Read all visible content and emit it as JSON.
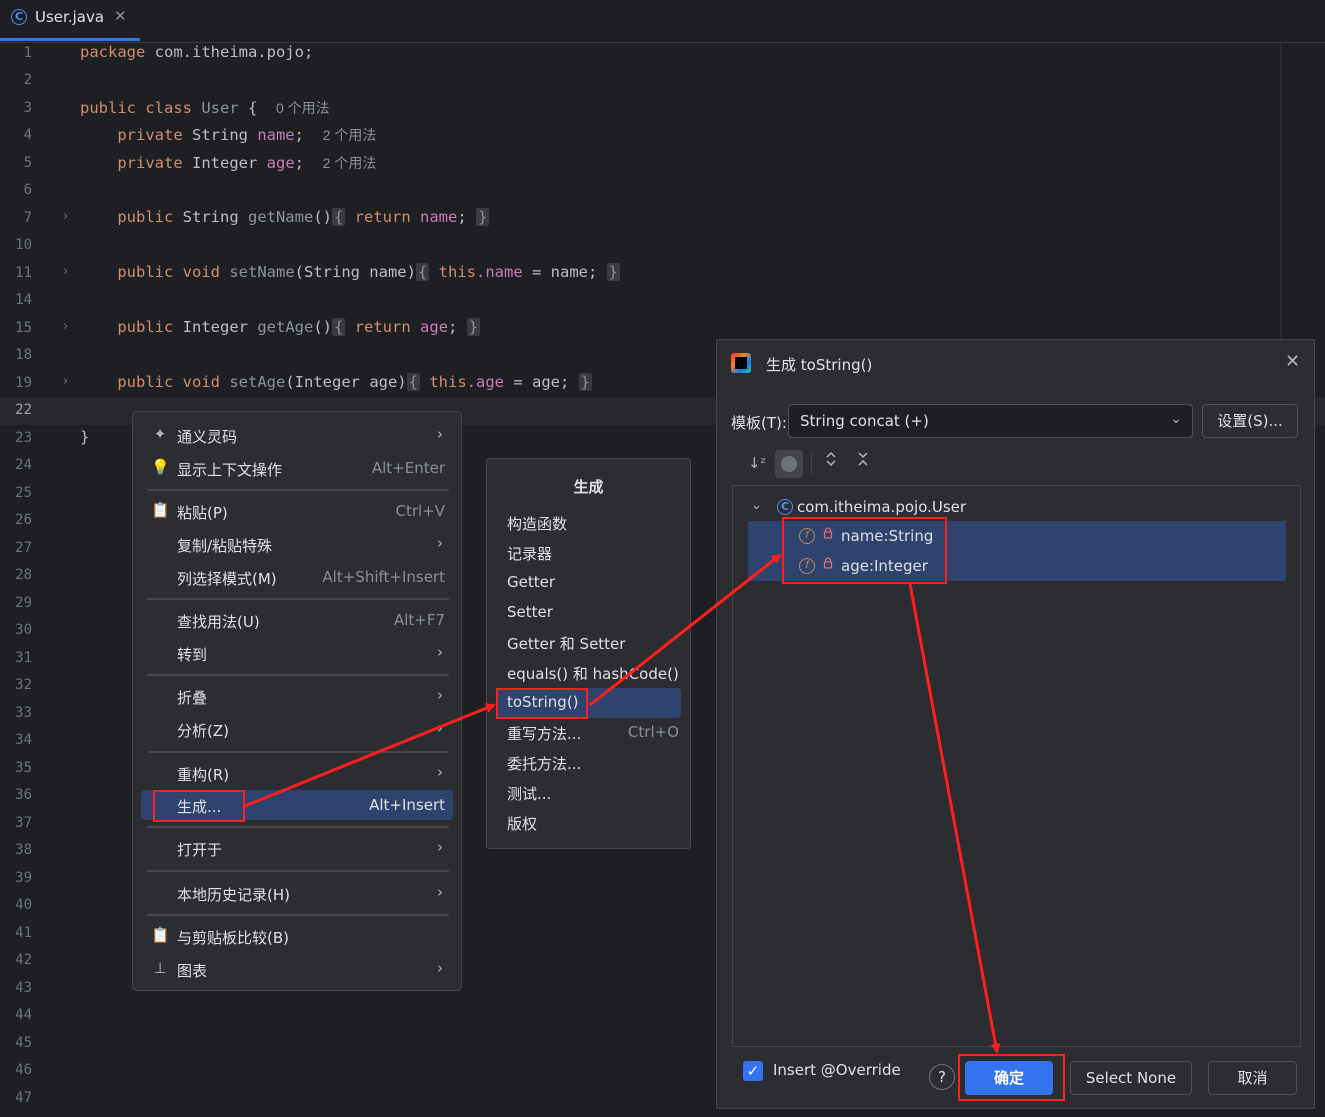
{
  "tab": {
    "title": "User.java",
    "close": "✕",
    "icon": "C"
  },
  "editor": {
    "lines": [
      {
        "n": "1"
      },
      {
        "n": "2"
      },
      {
        "n": "3"
      },
      {
        "n": "4"
      },
      {
        "n": "5"
      },
      {
        "n": "6"
      },
      {
        "n": "7"
      },
      {
        "n": "10"
      },
      {
        "n": "11"
      },
      {
        "n": "14"
      },
      {
        "n": "15"
      },
      {
        "n": "18"
      },
      {
        "n": "19"
      },
      {
        "n": "22"
      },
      {
        "n": "23"
      },
      {
        "n": "24"
      },
      {
        "n": "25"
      },
      {
        "n": "26"
      },
      {
        "n": "27"
      },
      {
        "n": "28"
      },
      {
        "n": "29"
      },
      {
        "n": "30"
      },
      {
        "n": "31"
      },
      {
        "n": "32"
      },
      {
        "n": "33"
      },
      {
        "n": "34"
      },
      {
        "n": "35"
      },
      {
        "n": "36"
      },
      {
        "n": "37"
      },
      {
        "n": "38"
      },
      {
        "n": "39"
      },
      {
        "n": "40"
      },
      {
        "n": "41"
      },
      {
        "n": "42"
      },
      {
        "n": "43"
      },
      {
        "n": "44"
      },
      {
        "n": "45"
      },
      {
        "n": "46"
      },
      {
        "n": "47"
      }
    ],
    "code": {
      "l1_kw": "package",
      "l1_rest": " com.itheima.pojo;",
      "l3_kw": "public class",
      "l3_name": "User",
      "l3_brace": " {",
      "l3_hint": "0 个用法",
      "l4_kw": "private",
      "l4_type": " String ",
      "l4_field": "name",
      "l4_semi": ";",
      "l4_hint": "2 个用法",
      "l5_kw": "private",
      "l5_type": " Integer ",
      "l5_field": "age",
      "l5_semi": ";",
      "l5_hint": "2 个用法",
      "l7_kw": "public",
      "l7_type": " String ",
      "l7_fn": "getName",
      "l7_paren": "()",
      "l7_ob": "{",
      "l7_ret": "return",
      "l7_field": "name",
      "l7_semi": ";",
      "l7_cb": "}",
      "l11_kw": "public void",
      "l11_fn": "setName",
      "l11_args": "(String name)",
      "l11_ob": "{",
      "l11_this": "this",
      "l11_field": ".name",
      "l11_assign": " = name;",
      "l11_cb": "}",
      "l15_kw": "public",
      "l15_type": " Integer ",
      "l15_fn": "getAge",
      "l15_paren": "()",
      "l15_ob": "{",
      "l15_ret": "return",
      "l15_field": "age",
      "l15_semi": ";",
      "l15_cb": "}",
      "l19_kw": "public void",
      "l19_fn": "setAge",
      "l19_args": "(Integer age)",
      "l19_ob": "{",
      "l19_this": "this",
      "l19_field": ".age",
      "l19_assign": " = age;",
      "l19_cb": "}",
      "l23": "}"
    },
    "fold_glyph": "›"
  },
  "context_menu": {
    "items": [
      {
        "icon": "✦",
        "label": "通义灵码",
        "shortcut": "",
        "arrow": "›"
      },
      {
        "icon": "💡",
        "label": "显示上下文操作",
        "shortcut": "Alt+Enter",
        "arrow": ""
      },
      {
        "icon": "📋",
        "label": "粘贴(P)",
        "shortcut": "Ctrl+V",
        "arrow": ""
      },
      {
        "icon": "",
        "label": "复制/粘贴特殊",
        "shortcut": "",
        "arrow": "›"
      },
      {
        "icon": "",
        "label": "列选择模式(M)",
        "shortcut": "Alt+Shift+Insert",
        "arrow": ""
      },
      {
        "icon": "",
        "label": "查找用法(U)",
        "shortcut": "Alt+F7",
        "arrow": ""
      },
      {
        "icon": "",
        "label": "转到",
        "shortcut": "",
        "arrow": "›"
      },
      {
        "icon": "",
        "label": "折叠",
        "shortcut": "",
        "arrow": "›"
      },
      {
        "icon": "",
        "label": "分析(Z)",
        "shortcut": "",
        "arrow": "›"
      },
      {
        "icon": "",
        "label": "重构(R)",
        "shortcut": "",
        "arrow": "›"
      },
      {
        "icon": "",
        "label": "生成...",
        "shortcut": "Alt+Insert",
        "arrow": ""
      },
      {
        "icon": "",
        "label": "打开于",
        "shortcut": "",
        "arrow": "›"
      },
      {
        "icon": "",
        "label": "本地历史记录(H)",
        "shortcut": "",
        "arrow": "›"
      },
      {
        "icon": "📋",
        "label": "与剪贴板比较(B)",
        "shortcut": "",
        "arrow": ""
      },
      {
        "icon": "⊥",
        "label": "图表",
        "shortcut": "",
        "arrow": "›"
      }
    ]
  },
  "generate_menu": {
    "title": "生成",
    "items": [
      {
        "label": "构造函数",
        "shortcut": ""
      },
      {
        "label": "记录器",
        "shortcut": ""
      },
      {
        "label": "Getter",
        "shortcut": ""
      },
      {
        "label": "Setter",
        "shortcut": ""
      },
      {
        "label": "Getter 和 Setter",
        "shortcut": ""
      },
      {
        "label": "equals() 和 hashCode()",
        "shortcut": ""
      },
      {
        "label": "toString()",
        "shortcut": ""
      },
      {
        "label": "重写方法...",
        "shortcut": "Ctrl+O"
      },
      {
        "label": "委托方法...",
        "shortcut": ""
      },
      {
        "label": "测试...",
        "shortcut": ""
      },
      {
        "label": "版权",
        "shortcut": ""
      }
    ]
  },
  "dialog": {
    "title": "生成 toString()",
    "close": "✕",
    "template_label": "模板(T):",
    "template_value": "String concat (+)",
    "template_chevron": "⌄",
    "settings_button": "设置(S)...",
    "toolbar": {
      "sort": "↓ᶻ",
      "expand": "⌃⌄",
      "collapse": "⨯"
    },
    "tree": {
      "root_chevron": "⌄",
      "root_label": "com.itheima.pojo.User",
      "root_icon": "C",
      "items": [
        {
          "icon": "f",
          "lock": "🔒",
          "label": "name:String"
        },
        {
          "icon": "f",
          "lock": "🔒",
          "label": "age:Integer"
        }
      ]
    },
    "override_checkbox": {
      "label": "Insert @Override",
      "checked": true,
      "glyph": "✓"
    },
    "help": "?",
    "ok_button": "确定",
    "select_none_button": "Select None",
    "cancel_button": "取消"
  },
  "accent_colors": {
    "annotation": "#ff1f1f",
    "selection": "#2e436e",
    "primary": "#3574f0"
  }
}
